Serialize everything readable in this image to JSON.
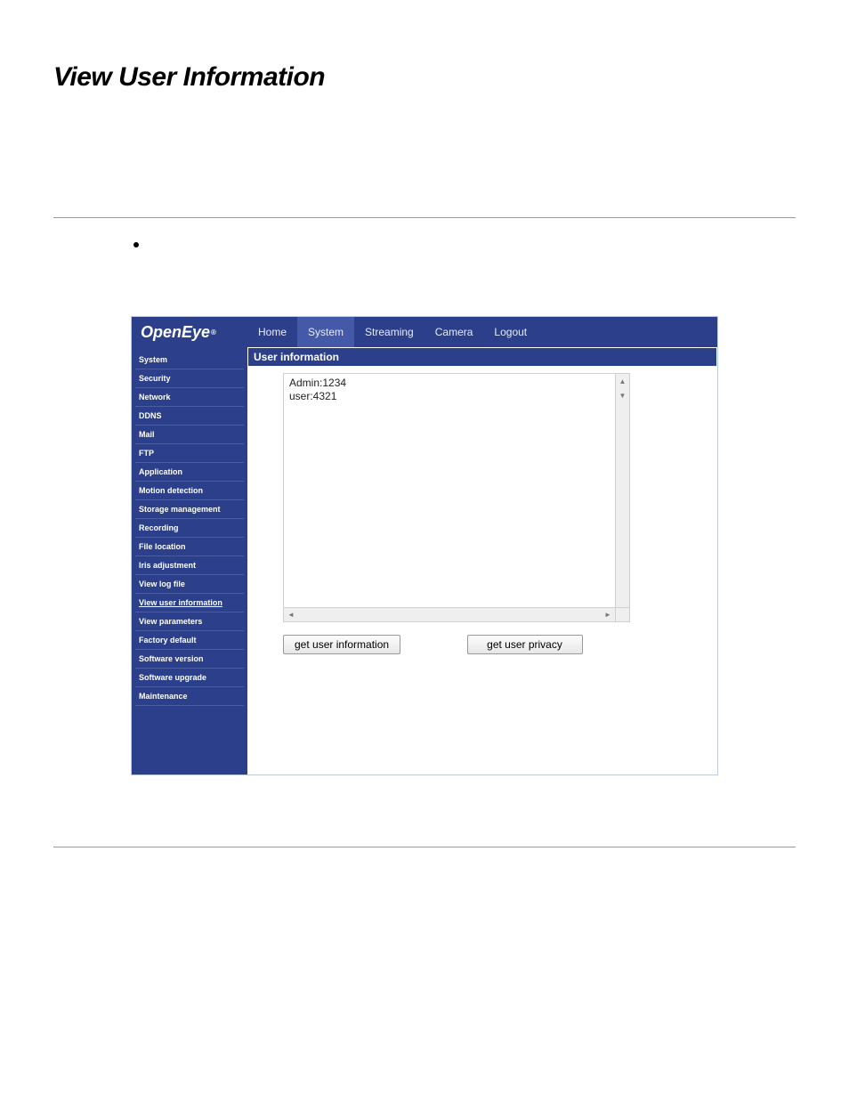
{
  "page": {
    "title": "View User Information"
  },
  "app": {
    "logo": "OpenEye",
    "tabs": [
      {
        "label": "Home",
        "active": false
      },
      {
        "label": "System",
        "active": true
      },
      {
        "label": "Streaming",
        "active": false
      },
      {
        "label": "Camera",
        "active": false
      },
      {
        "label": "Logout",
        "active": false
      }
    ],
    "sidebar": [
      {
        "label": "System"
      },
      {
        "label": "Security"
      },
      {
        "label": "Network"
      },
      {
        "label": "DDNS"
      },
      {
        "label": "Mail"
      },
      {
        "label": "FTP"
      },
      {
        "label": "Application"
      },
      {
        "label": "Motion detection"
      },
      {
        "label": "Storage management"
      },
      {
        "label": "Recording"
      },
      {
        "label": "File location"
      },
      {
        "label": "Iris adjustment"
      },
      {
        "label": "View log file"
      },
      {
        "label": "View user information",
        "underline": true
      },
      {
        "label": "View parameters"
      },
      {
        "label": "Factory default"
      },
      {
        "label": "Software version"
      },
      {
        "label": "Software upgrade"
      },
      {
        "label": "Maintenance"
      }
    ],
    "content": {
      "header": "User information",
      "lines": [
        "Admin:1234",
        "user:4321"
      ],
      "buttons": {
        "get_info": "get user information",
        "get_privacy": "get user privacy"
      }
    }
  }
}
